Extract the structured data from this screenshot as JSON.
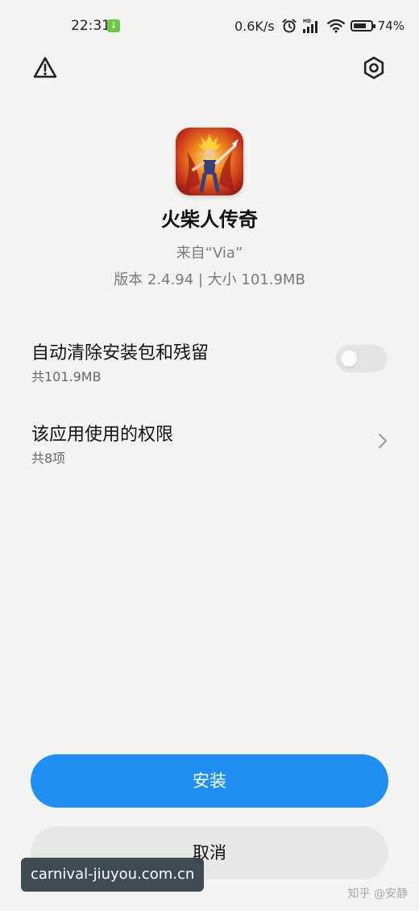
{
  "status_bar": {
    "time": "22:31",
    "download_badge": "↓",
    "network_speed": "0.6K/s",
    "hd_label": "HD",
    "battery_percent": "74%",
    "battery_level": 0.74,
    "icons": [
      "alarm-icon",
      "signal-icon",
      "wifi-icon",
      "battery-icon"
    ]
  },
  "top_bar": {
    "left_icon": "warning-icon",
    "right_icon": "settings-icon"
  },
  "app": {
    "name": "火柴人传奇",
    "source": "来自“Via”",
    "version_size": "版本 2.4.94 | 大小 101.9MB",
    "icon": "app-icon"
  },
  "settings": {
    "auto_clean": {
      "title": "自动清除安装包和残留",
      "subtitle": "共101.9MB",
      "enabled": false
    },
    "permissions": {
      "title": "该应用使用的权限",
      "subtitle": "共8项"
    }
  },
  "buttons": {
    "install": "安装",
    "cancel": "取消"
  },
  "colors": {
    "background": "#f3f4f1",
    "accent": "#1f8ff3",
    "cancel_bg": "#e7e8e5",
    "download_badge": "#6cc64a"
  },
  "watermarks": {
    "url": "carnival-jiuyou.com.cn",
    "zhihu": "知乎 @安静"
  }
}
